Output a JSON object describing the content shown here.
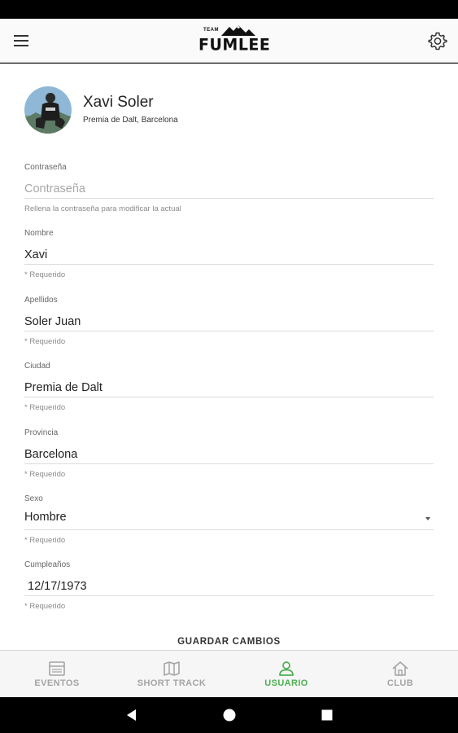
{
  "header": {
    "logo_small": "TEAM",
    "logo_text": "FUMLEE"
  },
  "profile": {
    "name": "Xavi Soler",
    "location": "Premia de Dalt, Barcelona"
  },
  "form": {
    "password": {
      "label": "Contraseña",
      "value": "",
      "placeholder": "Contraseña",
      "hint": "Rellena la contraseña para modificar la actual"
    },
    "nombre": {
      "label": "Nombre",
      "value": "Xavi",
      "hint": "* Requerido"
    },
    "apellidos": {
      "label": "Apellidos",
      "value": "Soler Juan",
      "hint": "* Requerido"
    },
    "ciudad": {
      "label": "Ciudad",
      "value": "Premia de Dalt",
      "hint": "* Requerido"
    },
    "provincia": {
      "label": "Provincia",
      "value": "Barcelona",
      "hint": "* Requerido"
    },
    "sexo": {
      "label": "Sexo",
      "value": "Hombre",
      "hint": "* Requerido"
    },
    "cumpleanos": {
      "label": "Cumpleaños",
      "value": "12/17/1973",
      "hint": "* Requerido"
    },
    "save_label": "GUARDAR CAMBIOS"
  },
  "bottom_nav": {
    "items": [
      {
        "label": "EVENTOS",
        "icon": "calendar-icon"
      },
      {
        "label": "SHORT TRACK",
        "icon": "map-icon"
      },
      {
        "label": "USUARIO",
        "icon": "user-icon",
        "active": true
      },
      {
        "label": "CLUB",
        "icon": "home-icon"
      }
    ]
  },
  "colors": {
    "accent": "#4caf50",
    "inactive": "#a4a4a4"
  }
}
